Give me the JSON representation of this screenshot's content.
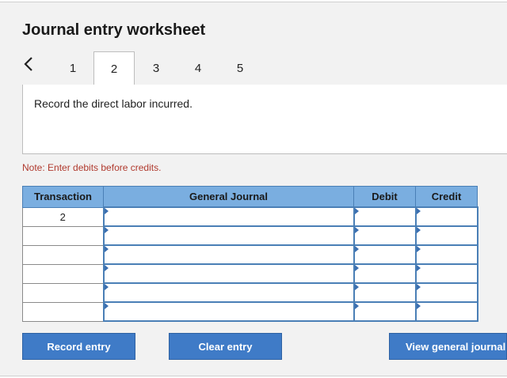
{
  "title": "Journal entry worksheet",
  "tabs": [
    "1",
    "2",
    "3",
    "4",
    "5"
  ],
  "active_tab": "2",
  "prompt": "Record the direct labor incurred.",
  "note": "Note: Enter debits before credits.",
  "table": {
    "headers": [
      "Transaction",
      "General Journal",
      "Debit",
      "Credit"
    ],
    "rows": [
      {
        "transaction": "2",
        "general_journal": "",
        "debit": "",
        "credit": ""
      },
      {
        "transaction": "",
        "general_journal": "",
        "debit": "",
        "credit": ""
      },
      {
        "transaction": "",
        "general_journal": "",
        "debit": "",
        "credit": ""
      },
      {
        "transaction": "",
        "general_journal": "",
        "debit": "",
        "credit": ""
      },
      {
        "transaction": "",
        "general_journal": "",
        "debit": "",
        "credit": ""
      },
      {
        "transaction": "",
        "general_journal": "",
        "debit": "",
        "credit": ""
      }
    ]
  },
  "buttons": {
    "record": "Record entry",
    "clear": "Clear entry",
    "view": "View general journal"
  },
  "colors": {
    "header_blue": "#7aaee0",
    "button_blue": "#3f7bc7",
    "note_red": "#b03a2e",
    "field_border": "#4a7fb6"
  },
  "icons": {
    "prev": "chevron-left-icon",
    "field_marker": "triangle-right-icon"
  }
}
